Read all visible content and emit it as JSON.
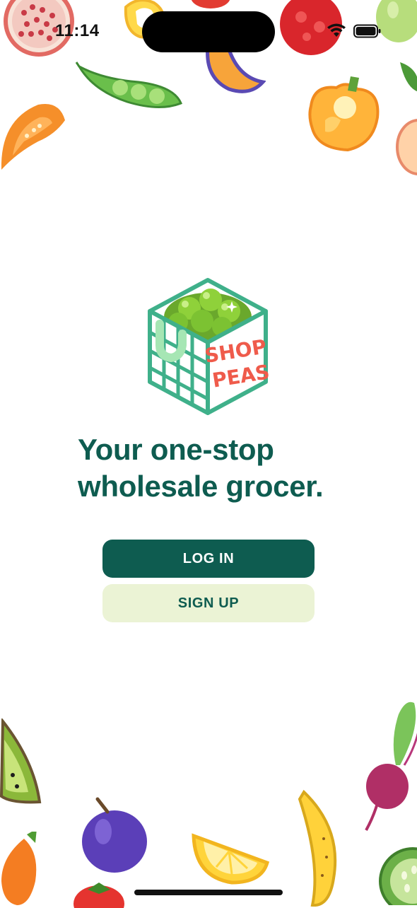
{
  "status_bar": {
    "time": "11:14"
  },
  "logo": {
    "text_line1": "SHOP",
    "text_line2": "PEAS"
  },
  "welcome": {
    "headline_line1": "Your one-stop",
    "headline_line2": "wholesale grocer."
  },
  "actions": {
    "login_label": "LOG IN",
    "signup_label": "SIGN UP"
  },
  "colors": {
    "primary": "#0e5c50",
    "secondary": "#ebf3d5",
    "logo_accent": "#ef5b4b",
    "logo_frame": "#3fb08a"
  }
}
